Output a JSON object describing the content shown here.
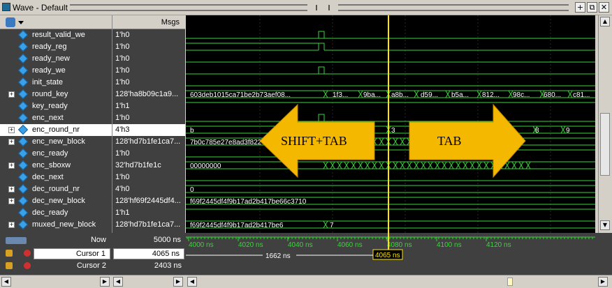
{
  "window": {
    "title": "Wave - Default"
  },
  "header": {
    "msgs_label": "Msgs"
  },
  "signals": [
    {
      "name": "result_valid_we",
      "value": "1'h0",
      "expandable": false
    },
    {
      "name": "ready_reg",
      "value": "1'h0",
      "expandable": false
    },
    {
      "name": "ready_new",
      "value": "1'h0",
      "expandable": false
    },
    {
      "name": "ready_we",
      "value": "1'h0",
      "expandable": false
    },
    {
      "name": "init_state",
      "value": "1'h0",
      "expandable": false
    },
    {
      "name": "round_key",
      "value": "128'ha8b09c1a9...",
      "expandable": true
    },
    {
      "name": "key_ready",
      "value": "1'h1",
      "expandable": false
    },
    {
      "name": "enc_next",
      "value": "1'h0",
      "expandable": false
    },
    {
      "name": "enc_round_nr",
      "value": "4'h3",
      "expandable": true,
      "selected": true
    },
    {
      "name": "enc_new_block",
      "value": "128'hd7b1fe1ca7...",
      "expandable": true
    },
    {
      "name": "enc_ready",
      "value": "1'h0",
      "expandable": false
    },
    {
      "name": "enc_sboxw",
      "value": "32'hd7b1fe1c",
      "expandable": true
    },
    {
      "name": "dec_next",
      "value": "1'h0",
      "expandable": false
    },
    {
      "name": "dec_round_nr",
      "value": "4'h0",
      "expandable": true
    },
    {
      "name": "dec_new_block",
      "value": "128'hf69f2445df4...",
      "expandable": true
    },
    {
      "name": "dec_ready",
      "value": "1'h1",
      "expandable": false
    },
    {
      "name": "muxed_new_block",
      "value": "128'hd7b1fe1ca7...",
      "expandable": true
    }
  ],
  "wave_labels": {
    "round_key": [
      "603deb1015ca71be2b73aef08...",
      "1f3...",
      "9ba...",
      "a8b...",
      "d59...",
      "b5a...",
      "812...",
      "98c...",
      "680...",
      "c81..."
    ],
    "enc_round_nr": [
      "b",
      "3",
      "8",
      "9"
    ],
    "enc_new_block": "7b0c785e27e8ad3f822",
    "enc_sboxw": "00000000",
    "dec_round_nr": "0",
    "dec_new_block": "f69f2445df4f9b17ad2b417be66c3710",
    "muxed_new_block": [
      "f69f2445df4f9b17ad2b417be6",
      "7"
    ]
  },
  "overlay": {
    "left_label": "SHIFT+TAB",
    "right_label": "TAB",
    "color": "#f5b800"
  },
  "status": {
    "now_label": "Now",
    "now_value": "5000 ns",
    "cursor1_label": "Cursor 1",
    "cursor1_value": "4065 ns",
    "cursor2_label": "Cursor 2",
    "cursor2_value": "2403 ns",
    "cursor1_flag": "4065 ns",
    "delta": "1662 ns"
  },
  "timeline": {
    "ticks": [
      "4000 ns",
      "4020 ns",
      "4040 ns",
      "4060 ns",
      "4080 ns",
      "4100 ns",
      "4120 ns"
    ]
  },
  "colors": {
    "wave": "#39d639",
    "cursor": "#ffe600",
    "panel": "#404040"
  }
}
